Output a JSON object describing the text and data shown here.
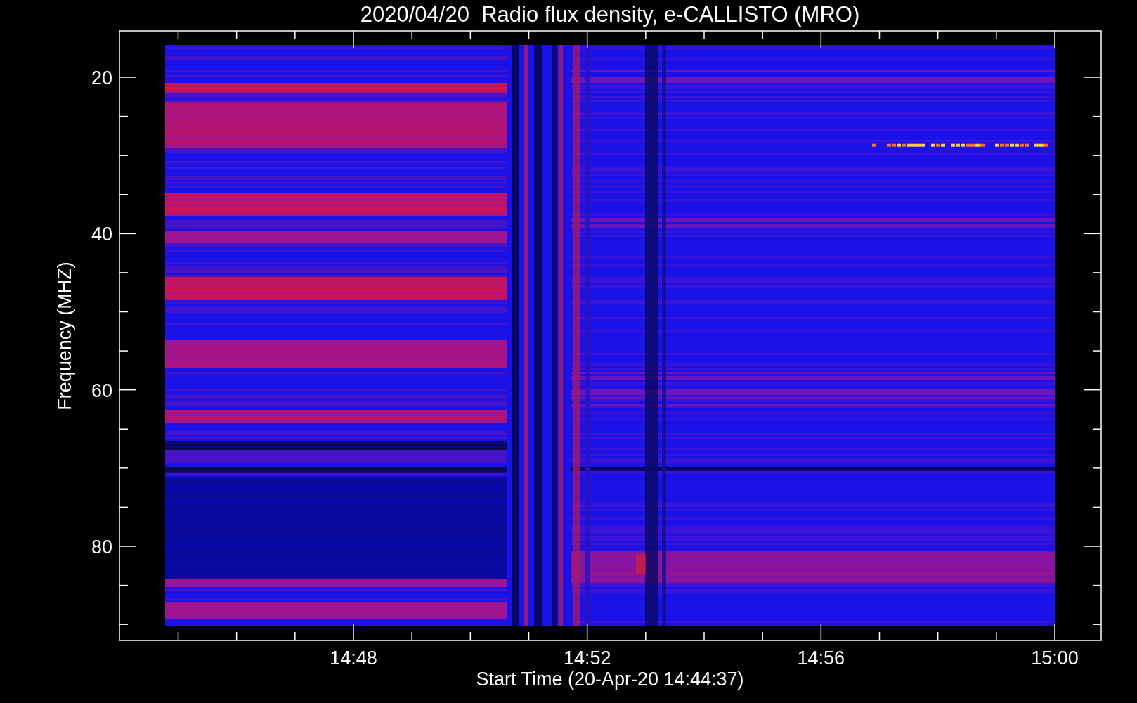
{
  "title": "2020/04/20  Radio flux density, e-CALLISTO (MRO)",
  "y_axis": {
    "label": "Frequency (MHZ)",
    "ticks": [
      "20",
      "40",
      "60",
      "80"
    ]
  },
  "x_axis": {
    "label": "Start Time (20-Apr-20 14:44:37)",
    "ticks": [
      "14:48",
      "14:52",
      "14:56",
      "15:00"
    ]
  }
}
